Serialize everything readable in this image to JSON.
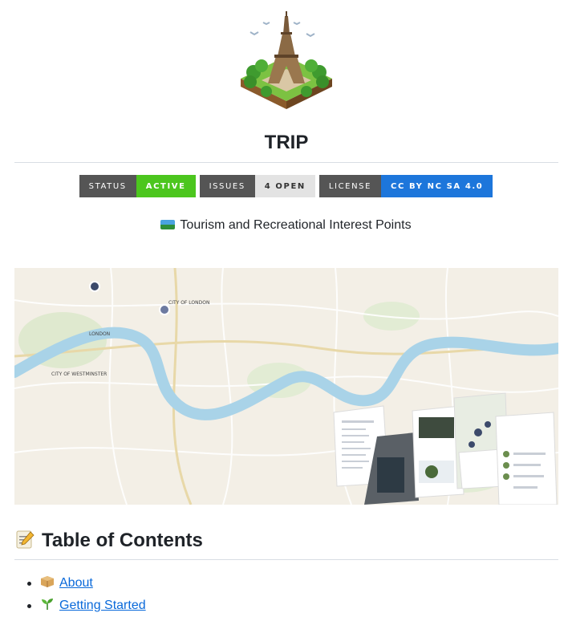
{
  "header": {
    "title": "TRIP",
    "subtitle": "Tourism and Recreational Interest Points"
  },
  "badges": [
    {
      "label": "STATUS",
      "value": "ACTIVE",
      "color": "#4cc61e"
    },
    {
      "label": "ISSUES",
      "value": "4 OPEN",
      "color": "#e3e3e3"
    },
    {
      "label": "LICENSE",
      "value": "CC BY NC SA 4.0",
      "color": "#1d76db"
    }
  ],
  "map": {
    "labels": [
      "CITY OF LONDON",
      "LONDON",
      "CITY OF WESTMINSTER"
    ]
  },
  "toc": {
    "heading": "Table of Contents",
    "items": [
      {
        "label": "About",
        "icon": "package-icon"
      },
      {
        "label": "Getting Started",
        "icon": "seedling-icon"
      }
    ]
  }
}
